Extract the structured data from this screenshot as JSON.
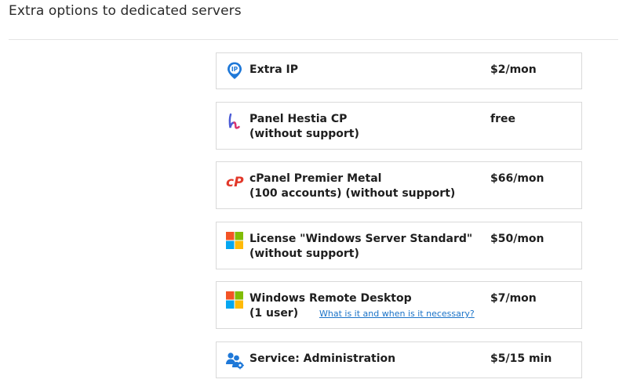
{
  "page": {
    "title": "Extra options to dedicated servers"
  },
  "options": [
    {
      "name": "Extra IP",
      "sub": "",
      "price": "$2/mon",
      "icon": "ip-pin-icon"
    },
    {
      "name": "Panel Hestia CP",
      "sub": "(without support)",
      "price": "free",
      "icon": "hestia-cp-logo-icon"
    },
    {
      "name": "cPanel Premier Metal",
      "sub": "(100 accounts) (without support)",
      "price": "$66/mon",
      "icon": "cpanel-logo-icon"
    },
    {
      "name": "License \"Windows Server Standard\"",
      "sub": "(without support)",
      "price": "$50/mon",
      "icon": "windows-logo-icon"
    },
    {
      "name": "Windows Remote Desktop",
      "sub": "(1 user)",
      "price": "$7/mon",
      "icon": "windows-logo-icon",
      "help_link": "What is it and when is it necessary?"
    },
    {
      "name": "Service: Administration",
      "sub": "",
      "price": "$5/15 min",
      "icon": "admin-users-icon"
    }
  ],
  "colors": {
    "ip_pin": "#1e78d8",
    "cpanel_red": "#e2382a",
    "win_red": "#f35325",
    "win_green": "#81bc06",
    "win_blue": "#05a6f0",
    "win_yellow": "#ffba08",
    "link": "#1a73c8",
    "admin_blue": "#1e78d8"
  }
}
